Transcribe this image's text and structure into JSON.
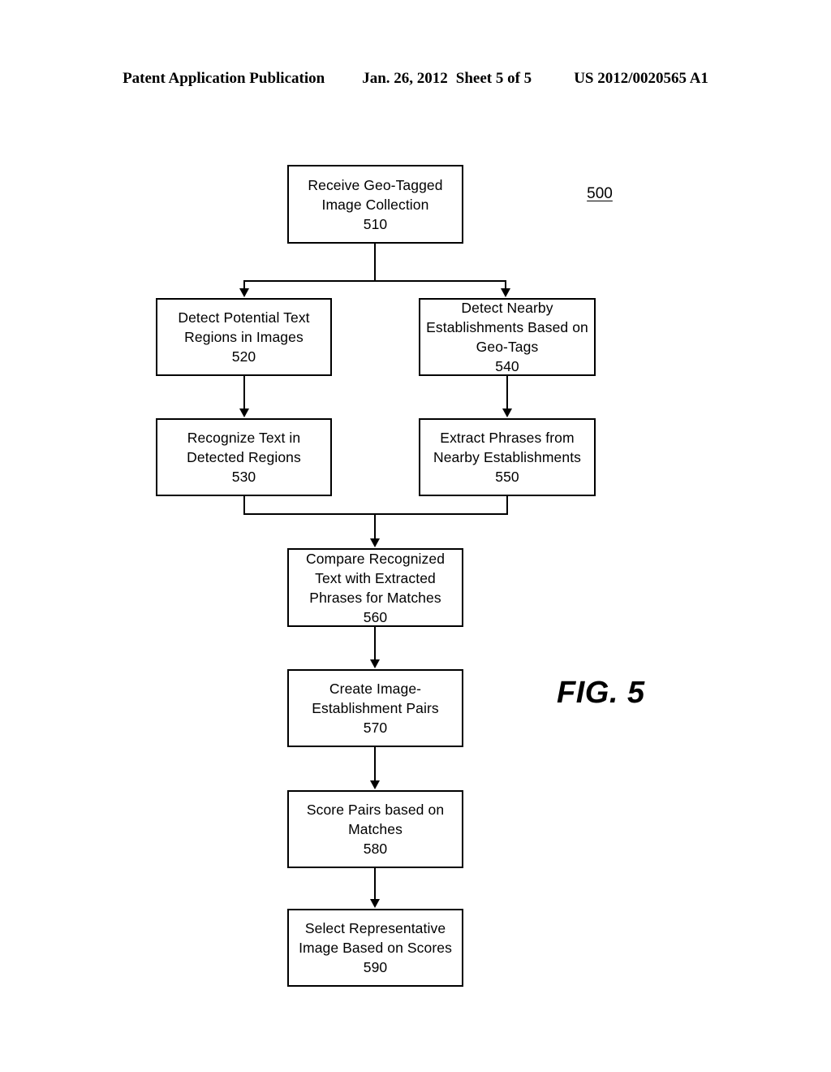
{
  "header": {
    "publication": "Patent Application Publication",
    "date": "Jan. 26, 2012",
    "sheet": "Sheet 5 of 5",
    "publication_number": "US 2012/0020565 A1"
  },
  "figure": {
    "label": "FIG. 5",
    "reference_numeral": "500",
    "nodes": {
      "n510": {
        "line1": "Receive Geo-Tagged",
        "line2": "Image Collection",
        "number": "510"
      },
      "n520": {
        "line1": "Detect Potential Text",
        "line2": "Regions in Images",
        "number": "520"
      },
      "n540": {
        "line1": "Detect Nearby",
        "line2": "Establishments Based on",
        "line3": "Geo-Tags",
        "number": "540"
      },
      "n530": {
        "line1": "Recognize Text in",
        "line2": "Detected Regions",
        "number": "530"
      },
      "n550": {
        "line1": "Extract Phrases from",
        "line2": "Nearby Establishments",
        "number": "550"
      },
      "n560": {
        "line1": "Compare Recognized",
        "line2": "Text with Extracted",
        "line3": "Phrases for Matches",
        "number": "560"
      },
      "n570": {
        "line1": "Create Image-",
        "line2": "Establishment Pairs",
        "number": "570"
      },
      "n580": {
        "line1": "Score Pairs based on",
        "line2": "Matches",
        "number": "580"
      },
      "n590": {
        "line1": "Select Representative",
        "line2": "Image Based on Scores",
        "number": "590"
      }
    }
  }
}
